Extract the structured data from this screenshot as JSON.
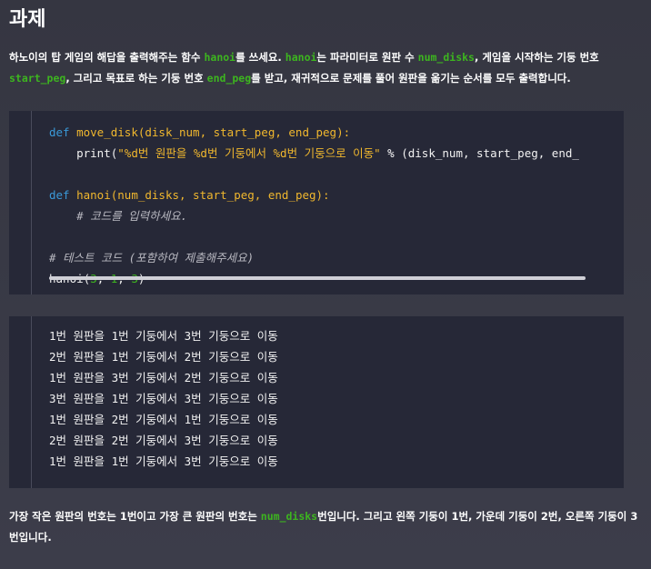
{
  "title": "과제",
  "description": {
    "p1": "하노이의 탑 게임의 해답을 출력해주는 함수 ",
    "fn1": "hanoi",
    "p2": "를 쓰세요. ",
    "fn2": "hanoi",
    "p3": "는 파라미터로 원판 수 ",
    "arg1": "num_disks",
    "p4": ", 게임을 시작하는 기둥 번호 ",
    "arg2": "start_peg",
    "p5": ", 그리고 목표로 하는 기둥 번호 ",
    "arg3": "end_peg",
    "p6": "를 받고, 재귀적으로 문제를 풀어 원판을 옮기는 순서를 모두 출력합니다."
  },
  "code": {
    "line1": {
      "kw": "def",
      "name": "move_disk",
      "params": "(disk_num, start_peg, end_peg):"
    },
    "line2": {
      "fn": "print",
      "paren": "(",
      "str": "\"%d번 원판을 %d번 기둥에서 %d번 기둥으로 이동\"",
      "op": " % ",
      "rest": "(disk_num, start_peg, end_"
    },
    "line3": {
      "kw": "def",
      "name": "hanoi",
      "params": "(num_disks, start_peg, end_peg):"
    },
    "line4": {
      "comment": "# 코드를 입력하세요."
    },
    "line5": {
      "comment": "# 테스트 코드 (포함하여 제출해주세요)"
    },
    "line6": {
      "call": "hanoi(",
      "a1": "3",
      "sep1": ", ",
      "a2": "1",
      "sep2": ", ",
      "a3": "3",
      "close": ")"
    }
  },
  "output": [
    "1번 원판을 1번 기둥에서 3번 기둥으로 이동",
    "2번 원판을 1번 기둥에서 2번 기둥으로 이동",
    "1번 원판을 3번 기둥에서 2번 기둥으로 이동",
    "3번 원판을 1번 기둥에서 3번 기둥으로 이동",
    "1번 원판을 2번 기둥에서 1번 기둥으로 이동",
    "2번 원판을 2번 기둥에서 3번 기둥으로 이동",
    "1번 원판을 1번 기둥에서 3번 기둥으로 이동"
  ],
  "footer": {
    "p1": "가장 작은 원판의 번호는 1번이고 가장 큰 원판의 번호는 ",
    "arg": "num_disks",
    "p2": "번입니다. 그리고 왼쪽 기둥이 1번, 가운데 기둥이 2번, 오른쪽 기둥이 3번입니다."
  },
  "colors": {
    "background": "#3a3b47",
    "code_bg": "#262837",
    "highlight_green": "#3db51f",
    "keyword_blue": "#3a99d8",
    "string_yellow": "#f0b72e"
  }
}
